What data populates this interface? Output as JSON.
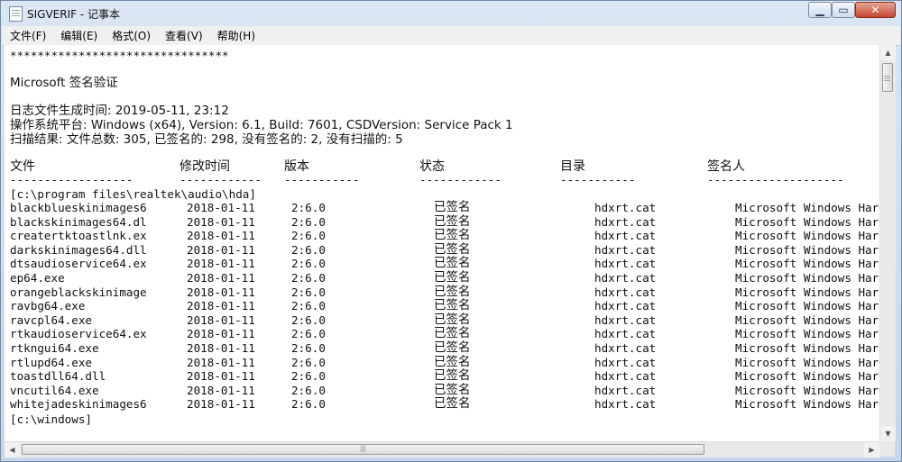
{
  "window": {
    "title": "SIGVERIF - 记事本",
    "min_label": "▁",
    "max_label": "▭",
    "close_label": "✕"
  },
  "menu": {
    "items": [
      "文件(F)",
      "编辑(E)",
      "格式(O)",
      "查看(V)",
      "帮助(H)"
    ]
  },
  "document": {
    "stars": "********************************",
    "heading": "Microsoft 签名验证",
    "log_time": "日志文件生成时间: 2019-05-11, 23:12",
    "os_platform": "操作系统平台:  Windows (x64), Version:  6.1, Build: 7601, CSDVersion:  Service Pack 1",
    "scan_result": "扫描结果:  文件总数: 305, 已签名的: 298, 没有签名的: 2, 没有扫描的: 5",
    "columns": [
      "文件",
      "修改时间",
      "版本",
      "状态",
      "目录",
      "签名人"
    ],
    "underlines": [
      "------------------",
      "------------",
      "-----------",
      "------------",
      "-----------",
      "--------------------"
    ],
    "dir1": "[c:\\program files\\realtek\\audio\\hda]",
    "rows": [
      [
        "blackblueskinimages6",
        "2018-01-11",
        "2:6.0",
        "已签名",
        "hdxrt.cat",
        "Microsoft Windows Har"
      ],
      [
        "blackskinimages64.dl",
        "2018-01-11",
        "2:6.0",
        "已签名",
        "hdxrt.cat",
        "Microsoft Windows Har"
      ],
      [
        "creatertktoastlnk.ex",
        "2018-01-11",
        "2:6.0",
        "已签名",
        "hdxrt.cat",
        "Microsoft Windows Har"
      ],
      [
        "darkskinimages64.dll",
        "2018-01-11",
        "2:6.0",
        "已签名",
        "hdxrt.cat",
        "Microsoft Windows Har"
      ],
      [
        "dtsaudioservice64.ex",
        "2018-01-11",
        "2:6.0",
        "已签名",
        "hdxrt.cat",
        "Microsoft Windows Har"
      ],
      [
        "ep64.exe",
        "2018-01-11",
        "2:6.0",
        "已签名",
        "hdxrt.cat",
        "Microsoft Windows Har"
      ],
      [
        "orangeblackskinimage",
        "2018-01-11",
        "2:6.0",
        "已签名",
        "hdxrt.cat",
        "Microsoft Windows Har"
      ],
      [
        "ravbg64.exe",
        "2018-01-11",
        "2:6.0",
        "已签名",
        "hdxrt.cat",
        "Microsoft Windows Har"
      ],
      [
        "ravcpl64.exe",
        "2018-01-11",
        "2:6.0",
        "已签名",
        "hdxrt.cat",
        "Microsoft Windows Har"
      ],
      [
        "rtkaudioservice64.ex",
        "2018-01-11",
        "2:6.0",
        "已签名",
        "hdxrt.cat",
        "Microsoft Windows Har"
      ],
      [
        "rtkngui64.exe",
        "2018-01-11",
        "2:6.0",
        "已签名",
        "hdxrt.cat",
        "Microsoft Windows Har"
      ],
      [
        "rtlupd64.exe",
        "2018-01-11",
        "2:6.0",
        "已签名",
        "hdxrt.cat",
        "Microsoft Windows Har"
      ],
      [
        "toastdll64.dll",
        "2018-01-11",
        "2:6.0",
        "已签名",
        "hdxrt.cat",
        "Microsoft Windows Har"
      ],
      [
        "vncutil64.exe",
        "2018-01-11",
        "2:6.0",
        "已签名",
        "hdxrt.cat",
        "Microsoft Windows Har"
      ],
      [
        "whitejadeskinimages6",
        "2018-01-11",
        "2:6.0",
        "已签名",
        "hdxrt.cat",
        "Microsoft Windows Har"
      ]
    ],
    "dir2": "[c:\\windows]"
  },
  "scroll": {
    "up": "▲",
    "down": "▼",
    "left": "◀",
    "right": "▶"
  }
}
